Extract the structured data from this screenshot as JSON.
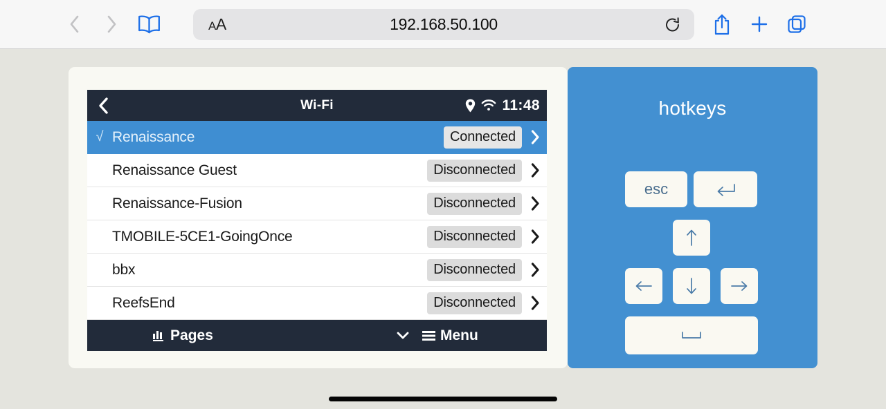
{
  "browser": {
    "back_icon": "chevron-left-icon",
    "forward_icon": "chevron-right-icon",
    "bookmarks_icon": "book-icon",
    "text_size_label": "A",
    "text_size_label_big": "A",
    "url": "192.168.50.100",
    "reload_icon": "reload-icon",
    "share_icon": "share-icon",
    "new_tab_icon": "plus-icon",
    "tabs_icon": "tabs-icon"
  },
  "device": {
    "header": {
      "back_icon": "chevron-left-icon",
      "title": "Wi-Fi",
      "location_icon": "location-pin-icon",
      "wifi_icon": "wifi-signal-icon",
      "time": "11:48"
    },
    "networks": [
      {
        "check": "√",
        "name": "Renaissance",
        "status": "Connected",
        "selected": true
      },
      {
        "check": "",
        "name": "Renaissance Guest",
        "status": "Disconnected",
        "selected": false
      },
      {
        "check": "",
        "name": "Renaissance-Fusion",
        "status": "Disconnected",
        "selected": false
      },
      {
        "check": "",
        "name": "TMOBILE-5CE1-GoingOnce",
        "status": "Disconnected",
        "selected": false
      },
      {
        "check": "",
        "name": "bbx",
        "status": "Disconnected",
        "selected": false
      },
      {
        "check": "",
        "name": "ReefsEnd",
        "status": "Disconnected",
        "selected": false
      }
    ],
    "footer": {
      "pages_icon": "bar-chart-icon",
      "pages_label": "Pages",
      "caret_icon": "chevron-down-icon",
      "menu_icon": "hamburger-icon",
      "menu_label": "Menu"
    }
  },
  "hotkeys": {
    "title": "hotkeys",
    "keys": [
      {
        "id": "esc",
        "label": "esc",
        "icon": ""
      },
      {
        "id": "enter",
        "label": "",
        "icon": "return-arrow-icon"
      },
      {
        "id": "up",
        "label": "",
        "icon": "arrow-up-icon"
      },
      {
        "id": "left",
        "label": "",
        "icon": "arrow-left-icon"
      },
      {
        "id": "down",
        "label": "",
        "icon": "arrow-down-icon"
      },
      {
        "id": "right",
        "label": "",
        "icon": "arrow-right-icon"
      },
      {
        "id": "space",
        "label": "",
        "icon": "spacebar-icon"
      }
    ]
  },
  "colors": {
    "accent_blue": "#1d6fe8",
    "panel_blue": "#4390d1",
    "row_selected_blue": "#3f8ed2",
    "device_chrome_dark": "#222b3a",
    "page_background": "#e4e4de",
    "card_background": "#f9f9f3"
  }
}
